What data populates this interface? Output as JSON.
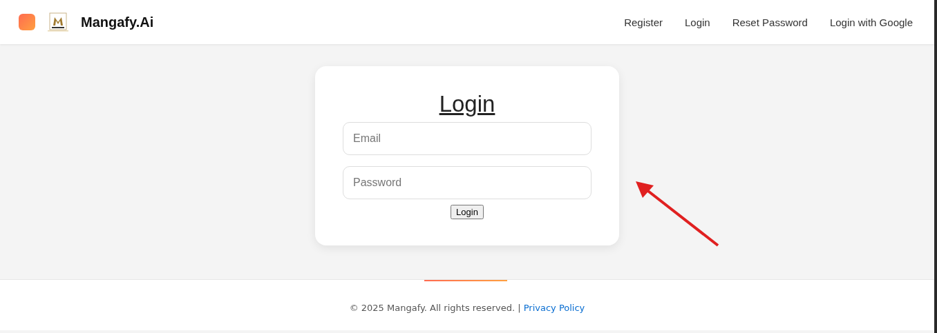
{
  "header": {
    "brand": "Mangafy.Ai",
    "nav": [
      "Register",
      "Login",
      "Reset Password",
      "Login with Google"
    ]
  },
  "card": {
    "title": "Login",
    "fields": [
      {
        "placeholder": "Email"
      },
      {
        "placeholder": "Password"
      }
    ],
    "button": "Login"
  },
  "footer": {
    "copyright": "© 2025 Mangafy. All rights reserved. |",
    "link": "Privacy Policy"
  }
}
